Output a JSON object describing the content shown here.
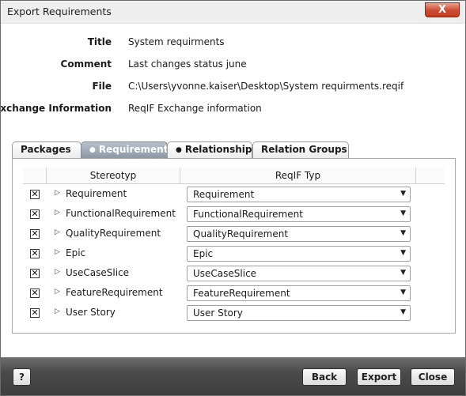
{
  "window": {
    "title": "Export Requirements",
    "close_glyph": "X"
  },
  "info": {
    "title_label": "Title",
    "title_value": "System requirments",
    "comment_label": "Comment",
    "comment_value": "Last changes status june",
    "file_label": "File",
    "file_value": "C:\\Users\\yvonne.kaiser\\Desktop\\System requirments.reqif",
    "exchange_label": "Exchange Information",
    "exchange_value": "ReqIF Exchange information"
  },
  "tabs": [
    {
      "label": "Packages",
      "active": false,
      "dot": ""
    },
    {
      "label": "Requirements",
      "active": true,
      "dot": "●"
    },
    {
      "label": "Relationships",
      "active": false,
      "dot": "●"
    },
    {
      "label": "Relation Groups",
      "active": false,
      "dot": ""
    }
  ],
  "grid": {
    "headers": {
      "stereotyp": "Stereotyp",
      "reqif_typ": "ReqIF Typ"
    },
    "check_glyph": "✕",
    "expand_glyph": "▷",
    "dropdown_glyph": "▼",
    "rows": [
      {
        "checked": true,
        "stereotype": "Requirement",
        "reqif_type": "Requirement"
      },
      {
        "checked": true,
        "stereotype": "FunctionalRequirement",
        "reqif_type": "FunctionalRequirement"
      },
      {
        "checked": true,
        "stereotype": "QualityRequirement",
        "reqif_type": "QualityRequirement"
      },
      {
        "checked": true,
        "stereotype": "Epic",
        "reqif_type": "Epic"
      },
      {
        "checked": true,
        "stereotype": "UseCaseSlice",
        "reqif_type": "UseCaseSlice"
      },
      {
        "checked": true,
        "stereotype": "FeatureRequirement",
        "reqif_type": "FeatureRequirement"
      },
      {
        "checked": true,
        "stereotype": "User Story",
        "reqif_type": "User Story"
      }
    ]
  },
  "footer": {
    "help_label": "?",
    "back_label": "Back",
    "export_label": "Export",
    "close_label": "Close"
  }
}
